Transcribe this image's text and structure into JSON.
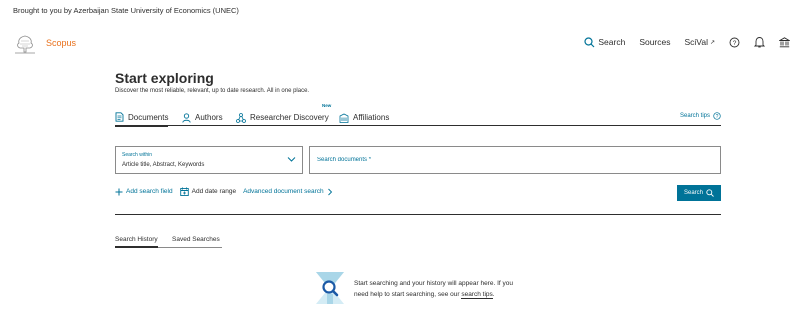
{
  "institution_bar": {
    "text": "Brought to you by Azerbaijan State University of Economics (UNEC)"
  },
  "header": {
    "brand": "Scopus",
    "nav": {
      "search_label": "Search",
      "sources_label": "Sources",
      "scival_label": "SciVal",
      "scival_ext": "↗"
    },
    "icons": [
      "search-icon",
      "help-icon",
      "bell-icon",
      "institution-icon",
      "external-link-icon"
    ]
  },
  "main": {
    "title": "Start exploring",
    "subtitle": "Discover the most reliable, relevant, up to date research. All in one place.",
    "tabs": [
      {
        "label": "Documents",
        "icon": "document-icon",
        "active": true
      },
      {
        "label": "Authors",
        "icon": "person-icon",
        "active": false
      },
      {
        "label": "Researcher Discovery",
        "icon": "network-icon",
        "active": false,
        "badge": "New"
      },
      {
        "label": "Affiliations",
        "icon": "building-icon",
        "active": false
      }
    ],
    "search_tips": "Search tips",
    "search_within": {
      "label": "Search within",
      "value": "Article title, Abstract, Keywords"
    },
    "search_documents": {
      "placeholder": "Search documents *"
    },
    "actions": {
      "add_field": "Add search field",
      "add_date": "Add date range",
      "advanced": "Advanced document search"
    },
    "search_button": "Search",
    "history_tabs": [
      {
        "label": "Search History",
        "active": true
      },
      {
        "label": "Saved Searches",
        "active": false
      }
    ],
    "empty_state": {
      "line1": "Start searching and your history will appear here. If you",
      "line2_prefix": "need help to start searching, see our ",
      "line2_link": "search tips",
      "line2_suffix": "."
    }
  },
  "colors": {
    "brand": "#e9711c",
    "accent": "#007398",
    "text": "#2e2e2e"
  }
}
